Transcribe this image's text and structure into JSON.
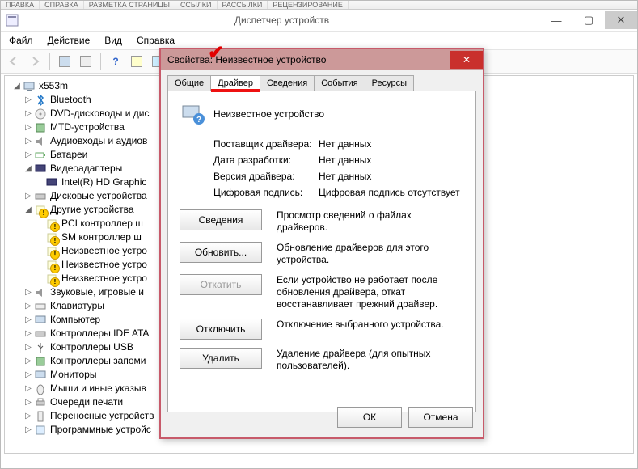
{
  "window": {
    "title": "Диспетчер устройств"
  },
  "menu": {
    "file": "Файл",
    "action": "Действие",
    "view": "Вид",
    "help": "Справка"
  },
  "tree": {
    "root": "x553m",
    "bluetooth": "Bluetooth",
    "dvd": "DVD-дисководы и дис",
    "mtd": "MTD-устройства",
    "audio": "Аудиовходы и аудиов",
    "battery": "Батареи",
    "video": "Видеоадаптеры",
    "video_child": "Intel(R) HD Graphic",
    "disk": "Дисковые устройства",
    "other": "Другие устройства",
    "other_pci": "PCI контроллер ш",
    "other_sm": "SM контроллер ш",
    "other_unk1": "Неизвестное устро",
    "other_unk2": "Неизвестное устро",
    "other_unk3": "Неизвестное устро",
    "sound": "Звуковые, игровые и",
    "keyboard": "Клавиатуры",
    "computer": "Компьютер",
    "ide": "Контроллеры IDE ATA",
    "usb": "Контроллеры USB",
    "storage_ctrl": "Контроллеры запоми",
    "monitor": "Мониторы",
    "mouse": "Мыши и иные указыв",
    "print_queue": "Очереди печати",
    "portable": "Переносные устройств",
    "software_dev": "Программные устройс"
  },
  "dialog": {
    "title": "Свойства: Неизвестное устройство",
    "tabs": {
      "general": "Общие",
      "driver": "Драйвер",
      "details": "Сведения",
      "events": "События",
      "resources": "Ресурсы"
    },
    "device_name": "Неизвестное устройство",
    "labels": {
      "provider": "Поставщик драйвера:",
      "date": "Дата разработки:",
      "version": "Версия драйвера:",
      "signer": "Цифровая подпись:"
    },
    "values": {
      "provider": "Нет данных",
      "date": "Нет данных",
      "version": "Нет данных",
      "signer": "Цифровая подпись отсутствует"
    },
    "buttons": {
      "details": "Сведения",
      "details_desc": "Просмотр сведений о файлах драйверов.",
      "update": "Обновить...",
      "update_desc": "Обновление драйверов для этого устройства.",
      "rollback": "Откатить",
      "rollback_desc": "Если устройство не работает после обновления драйвера, откат восстанавливает прежний драйвер.",
      "disable": "Отключить",
      "disable_desc": "Отключение выбранного устройства.",
      "uninstall": "Удалить",
      "uninstall_desc": "Удаление драйвера (для опытных пользователей).",
      "ok": "ОК",
      "cancel": "Отмена"
    }
  }
}
